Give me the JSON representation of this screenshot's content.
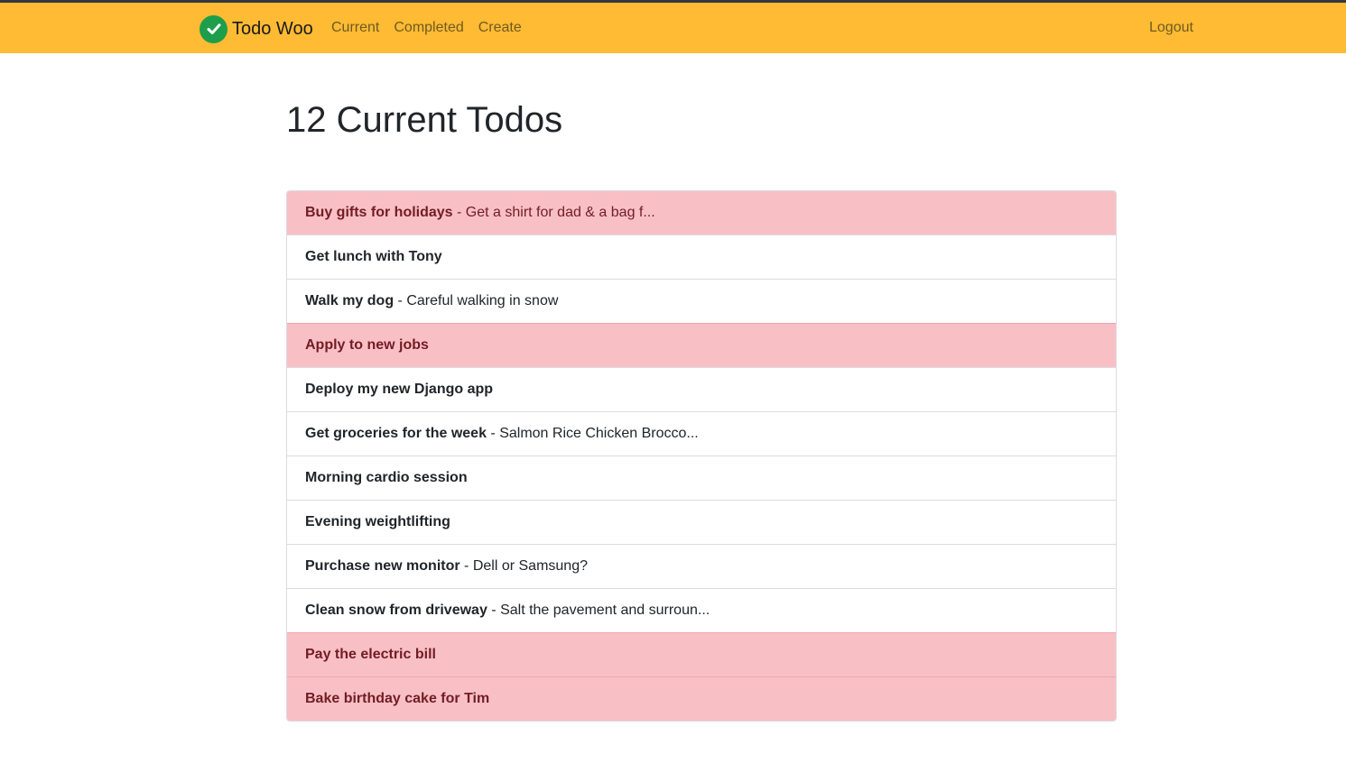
{
  "navbar": {
    "brand": "Todo Woo",
    "brand_icon": "check-circle-icon",
    "accent_color": "#ffbb33",
    "links": [
      "Current",
      "Completed",
      "Create"
    ],
    "logout": "Logout"
  },
  "main": {
    "title": "12 Current Todos",
    "todos": [
      {
        "title": "Buy gifts for holidays",
        "desc": " - Get a shirt for dad & a bag f...",
        "important": true
      },
      {
        "title": "Get lunch with Tony",
        "desc": "",
        "important": false
      },
      {
        "title": "Walk my dog",
        "desc": " - Careful walking in snow",
        "important": false
      },
      {
        "title": "Apply to new jobs",
        "desc": "",
        "important": true
      },
      {
        "title": "Deploy my new Django app",
        "desc": "",
        "important": false
      },
      {
        "title": "Get groceries for the week",
        "desc": " - Salmon Rice Chicken Brocco...",
        "important": false
      },
      {
        "title": "Morning cardio session",
        "desc": "",
        "important": false
      },
      {
        "title": "Evening weightlifting",
        "desc": "",
        "important": false
      },
      {
        "title": "Purchase new monitor",
        "desc": " - Dell or Samsung?",
        "important": false
      },
      {
        "title": "Clean snow from driveway",
        "desc": " - Salt the pavement and surroun...",
        "important": false
      },
      {
        "title": "Pay the electric bill",
        "desc": "",
        "important": true
      },
      {
        "title": "Bake birthday cake for Tim",
        "desc": "",
        "important": true
      }
    ]
  }
}
